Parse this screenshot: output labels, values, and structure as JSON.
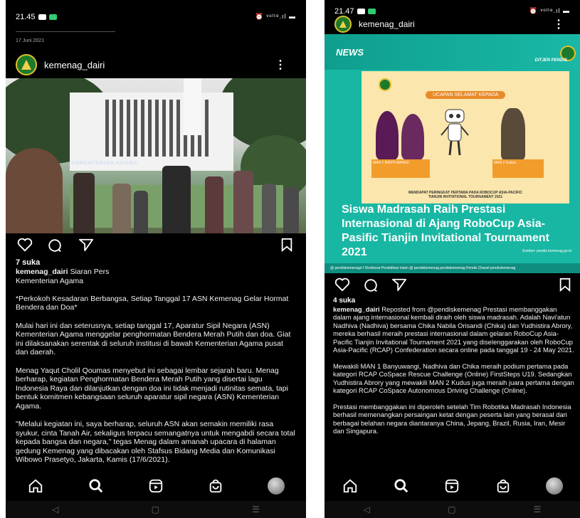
{
  "left": {
    "status_time": "21.45",
    "status_sys": "⏰ ᵛᵒˡᵗᵉ.ıl ▬",
    "post_date": "17 Juni 2021",
    "username": "kemenag_dairi",
    "photo_sign": "KEMENTERIAN AGAMA",
    "likes": "7 suka",
    "caption_user": "kemenag_dairi",
    "caption_lead": "Siaran Pers",
    "paragraphs": [
      "Kementerian Agama",
      "*Perkokoh Kesadaran Berbangsa, Setiap Tanggal 17 ASN Kemenag Gelar Hormat Bendera dan Doa*",
      "Mulai hari ini dan seterusnya, setiap tanggal 17, Aparatur Sipil Negara (ASN) Kementerian Agama menggelar penghormatan Bendera Merah Putih dan doa. Giat ini dilaksanakan serentak di seluruh institusi di bawah Kementerian Agama pusat dan daerah.",
      "Menag Yaqut Cholil Qoumas menyebut ini sebagai lembar sejarah baru. Menag berharap, kegiatan Penghormatan Bendera Merah Putih yang disertai lagu Indonesia Raya dan dilanjutkan dengan doa ini tidak menjadi rutinitas semata, tapi bentuk komitmen kebangsaan seluruh aparatur sipil negara (ASN) Kementerian Agama.",
      "\"Melalui kegiatan ini, saya berharap, seluruh ASN akan semakin memiliki rasa syukur, cinta Tanah Air, sekaligus terpacu semangatnya untuk mengabdi secara total kepada bangsa dan negara,\" tegas Menag dalam amanah upacara di halaman gedung Kemenag yang dibacakan oleh Stafsus Bidang Media dan Komunikasi Wibowo Prasetyo, Jakarta, Kamis (17/6/2021)."
    ]
  },
  "right": {
    "status_time": "21.47",
    "status_sys": "⏰ ᵛᵒˡᵗᵉ.ıl ▬",
    "username": "kemenag_dairi",
    "news_tag": "NEWS",
    "ditjen": "DITJEN PENDIS",
    "poster_title": "UCAPAN SELAMAT KEPADA",
    "poster_name_1": "MAN 1 BANYUWANGI",
    "poster_name_2": "MAN 2 Kudus",
    "poster_sub": "MENDAPAT PERINGKAT PERTAMA PADA ROBOCUP ASIA-PACIFIC TIANJIN INVITATIONAL TOURNAMENT 2021",
    "headline": "Siswa Madrasah Raih Prestasi Internasional di Ajang RoboCup Asia-Pasific Tianjin Invitational Tournament 2021",
    "source": "Sumber: pendis.kemenag.go.id",
    "social": "@ pendiskemenagri   f Direktorat Pendidikan Islam   @ pendiskemenag   pendiskemenag   Pendis Chanel   pendiskemenag",
    "likes": "4 suka",
    "caption_user": "kemenag_dairi",
    "paragraphs": [
      "Reposted from @pendiskemenag Prestasi membanggakan dalam ajang internasional kembali diraih oleh siswa madrasah. Adalah Navi'atun Nadhiva (Nadhiva) bersama Chika Nabila Orisandi (Chika) dan Yudhistira Abrory, mereka berhasil meraih prestasi internasional dalam gelaran RoboCup Asia-Pacific Tianjin Invitational Tournament 2021 yang diselenggarakan oleh RoboCup Asia-Pacific (RCAP) Confederation secara online pada tanggal 19 - 24 May 2021.",
      "Mewakili MAN 1 Banyuwangi, Nadhiva dan Chika meraih podium pertama pada kategori RCAP CoSpace Rescue Challenge (Online) FirstSteps U19. Sedangkan Yudhistira Abrory yang mewakili MAN 2 Kudus juga meraih juara pertama dengan kategori RCAP CoSpace Autonomous Driving Challenge (Online).",
      "Prestasi membanggakan ini diperoleh setelah Tim Robotika Madrasah Indonesia berhasil memenangkan persaingan ketat dengan peserta lain yang berasal dari berbagai belahan negara diantaranya China, Jepang, Brazil, Rusia, Iran, Mesir dan Singapura."
    ]
  }
}
